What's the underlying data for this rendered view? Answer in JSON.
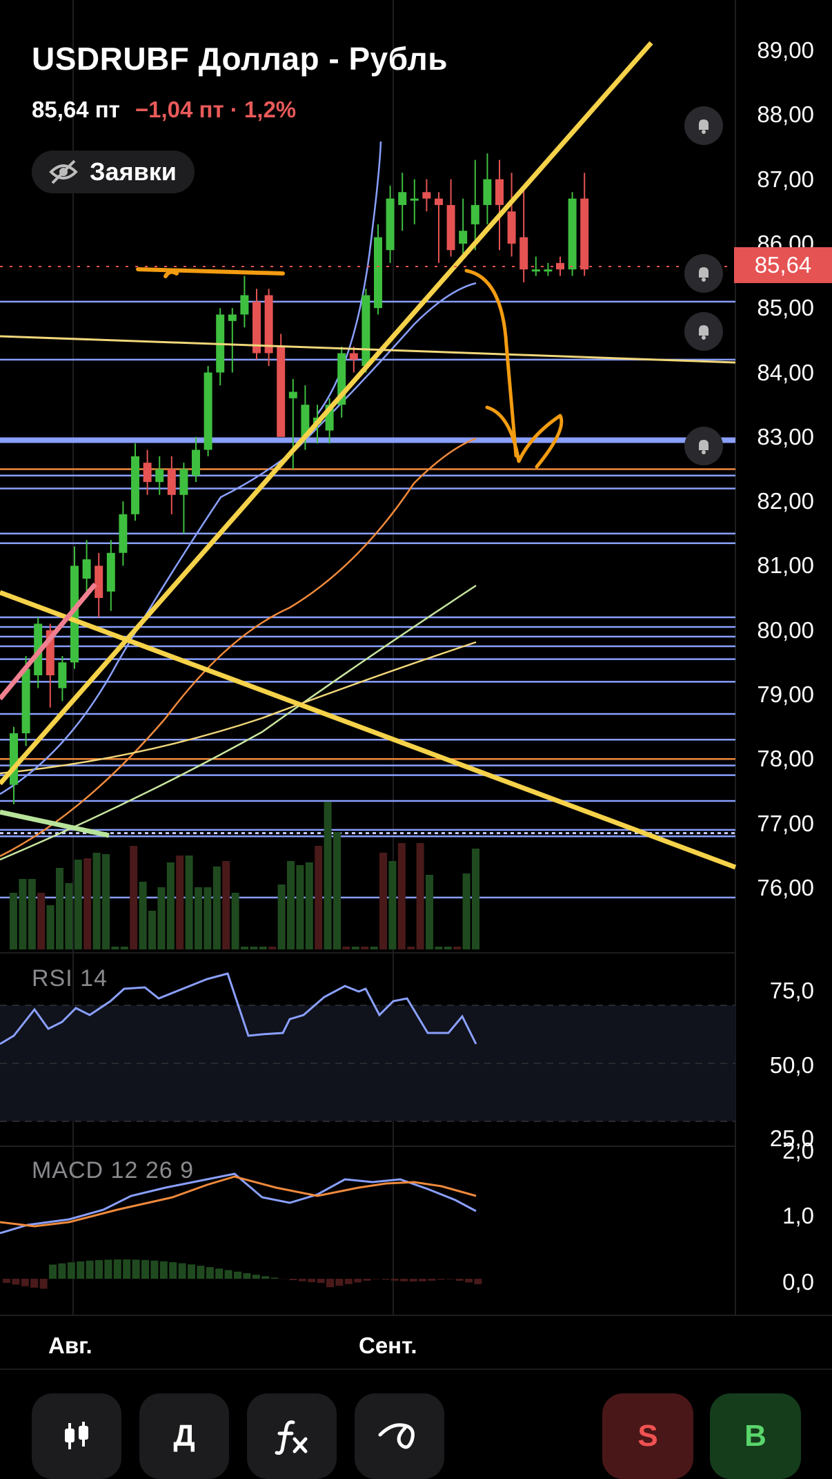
{
  "header": {
    "title": "USDRUBF Доллар - Рубль",
    "price": "85,64 пт",
    "change": "−1,04 пт · 1,2%",
    "orders_label": "Заявки"
  },
  "current_price_tag": "85,64",
  "price_axis": [
    "89,00",
    "88,00",
    "87,00",
    "86,00",
    "85,00",
    "84,00",
    "83,00",
    "82,00",
    "81,00",
    "80,00",
    "79,00",
    "78,00",
    "77,00",
    "76,00"
  ],
  "rsi": {
    "label": "RSI 14",
    "axis": [
      "75,0",
      "50,0",
      "25,0"
    ]
  },
  "macd": {
    "label": "MACD 12 26 9",
    "axis": [
      "2,0",
      "1,0",
      "0,0"
    ]
  },
  "x_axis": [
    "Авг.",
    "Сент."
  ],
  "toolbar": {
    "candles_icon": "candlestick-icon",
    "period_label": "Д",
    "indicators_icon": "function-icon",
    "drawing_icon": "drawing-icon",
    "sell_label": "S",
    "buy_label": "B"
  },
  "colors": {
    "up": "#3fbf3f",
    "down": "#e55353",
    "accent_blue": "#8aa0ff",
    "trend_yellow": "#f5d24a",
    "annotation_orange": "#f39c12"
  }
}
